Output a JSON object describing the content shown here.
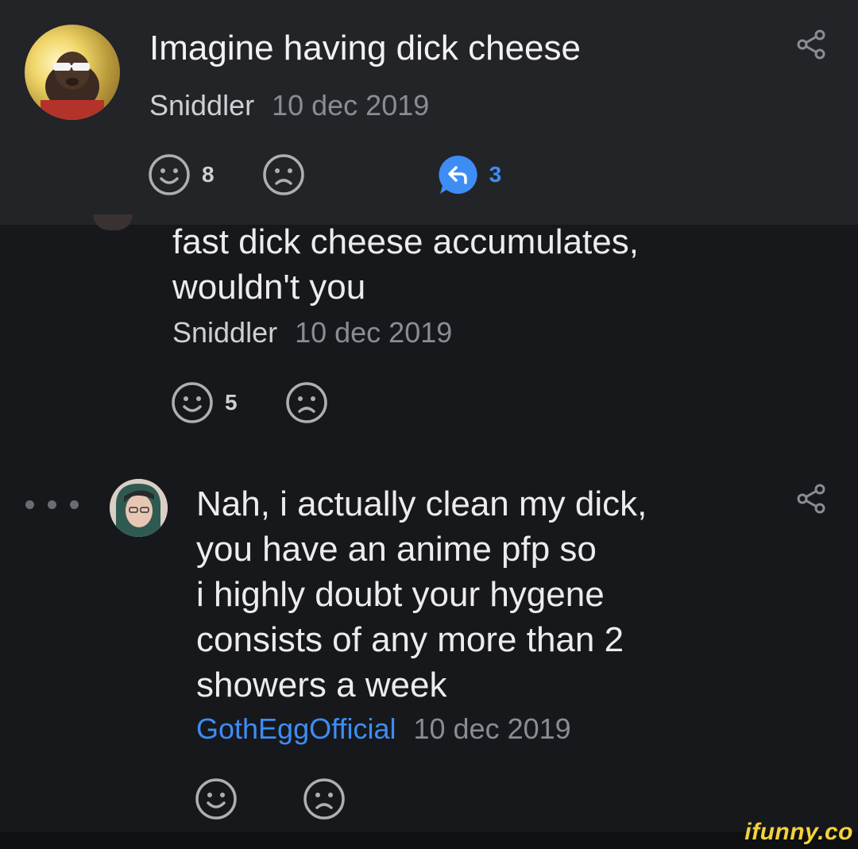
{
  "post": {
    "title": "Imagine having dick cheese",
    "author": "Sniddler",
    "date": "10 dec 2019",
    "likes": "8",
    "replies": "3",
    "icons": [
      "smile-icon",
      "frown-icon",
      "reply-bubble-icon",
      "share-icon"
    ]
  },
  "reply1": {
    "lines": [
      "fast dick cheese accumulates,",
      "wouldn't you"
    ],
    "author": "Sniddler",
    "date": "10 dec 2019",
    "likes": "5"
  },
  "reply2": {
    "lines": [
      "Nah, i actually clean my dick,",
      "you have an anime pfp so",
      "i highly doubt your hygene",
      "consists of any more than 2",
      "showers a week"
    ],
    "author": "GothEggOfficial",
    "date": "10 dec 2019"
  },
  "watermark": "ifunny.co",
  "colors": {
    "background": "#17181c",
    "card": "#232428",
    "accent_blue": "#3d8df5",
    "muted": "#8b8c91",
    "watermark": "#f5d23a"
  }
}
